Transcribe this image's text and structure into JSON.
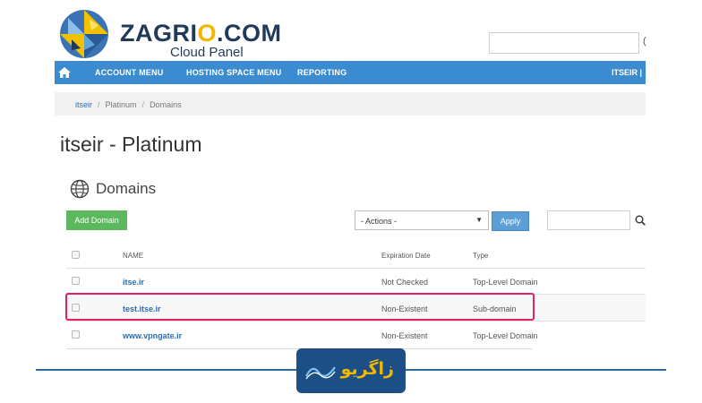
{
  "brand": {
    "name_pre": "ZAGRI",
    "name_o": "O",
    "name_post": ".COM",
    "subtitle": "Cloud Panel"
  },
  "header": {
    "search_placeholder": "",
    "search_tail": "("
  },
  "nav": {
    "items": [
      "ACCOUNT MENU",
      "HOSTING SPACE MENU",
      "REPORTING"
    ],
    "user": "ITSEIR |"
  },
  "breadcrumb": [
    "itseir",
    "Platinum",
    "Domains"
  ],
  "page": {
    "title": "itseir - Platinum"
  },
  "section": {
    "title": "Domains"
  },
  "toolbar": {
    "add_label": "Add Domain",
    "actions_value": "- Actions -",
    "apply_label": "Apply",
    "filter_value": ""
  },
  "table": {
    "headers": {
      "name": "NAME",
      "expiration": "Expiration Date",
      "type": "Type"
    },
    "rows": [
      {
        "name": "itse.ir",
        "expiration": "Not Checked",
        "type": "Top-Level Domain"
      },
      {
        "name": "test.itse.ir",
        "expiration": "Non-Existent",
        "type": "Sub-domain"
      },
      {
        "name": "www.vpngate.ir",
        "expiration": "Non-Existent",
        "type": "Top-Level Domain"
      }
    ]
  },
  "watermark": {
    "text": "زاگریو"
  },
  "colors": {
    "nav": "#3a8bd0",
    "add_button": "#5cb85c",
    "highlight": "#e0245e",
    "badge": "#1b4f86",
    "badge_text": "#f5b800"
  }
}
